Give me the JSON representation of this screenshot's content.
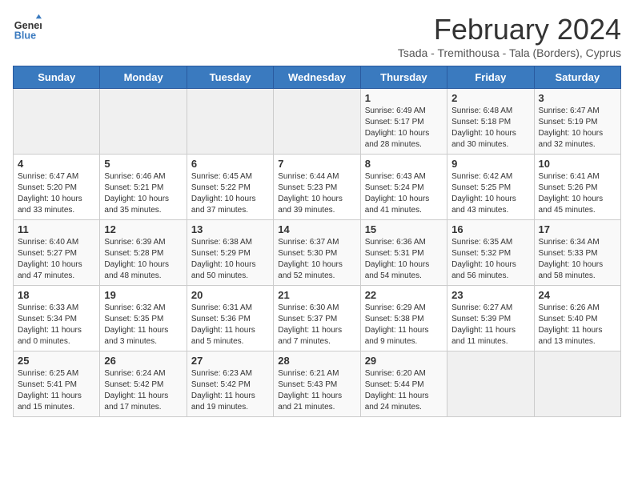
{
  "logo": {
    "general": "General",
    "blue": "Blue"
  },
  "title": "February 2024",
  "subtitle": "Tsada - Tremithousa - Tala (Borders), Cyprus",
  "days_of_week": [
    "Sunday",
    "Monday",
    "Tuesday",
    "Wednesday",
    "Thursday",
    "Friday",
    "Saturday"
  ],
  "weeks": [
    [
      {
        "day": "",
        "info": ""
      },
      {
        "day": "",
        "info": ""
      },
      {
        "day": "",
        "info": ""
      },
      {
        "day": "",
        "info": ""
      },
      {
        "day": "1",
        "info": "Sunrise: 6:49 AM\nSunset: 5:17 PM\nDaylight: 10 hours\nand 28 minutes."
      },
      {
        "day": "2",
        "info": "Sunrise: 6:48 AM\nSunset: 5:18 PM\nDaylight: 10 hours\nand 30 minutes."
      },
      {
        "day": "3",
        "info": "Sunrise: 6:47 AM\nSunset: 5:19 PM\nDaylight: 10 hours\nand 32 minutes."
      }
    ],
    [
      {
        "day": "4",
        "info": "Sunrise: 6:47 AM\nSunset: 5:20 PM\nDaylight: 10 hours\nand 33 minutes."
      },
      {
        "day": "5",
        "info": "Sunrise: 6:46 AM\nSunset: 5:21 PM\nDaylight: 10 hours\nand 35 minutes."
      },
      {
        "day": "6",
        "info": "Sunrise: 6:45 AM\nSunset: 5:22 PM\nDaylight: 10 hours\nand 37 minutes."
      },
      {
        "day": "7",
        "info": "Sunrise: 6:44 AM\nSunset: 5:23 PM\nDaylight: 10 hours\nand 39 minutes."
      },
      {
        "day": "8",
        "info": "Sunrise: 6:43 AM\nSunset: 5:24 PM\nDaylight: 10 hours\nand 41 minutes."
      },
      {
        "day": "9",
        "info": "Sunrise: 6:42 AM\nSunset: 5:25 PM\nDaylight: 10 hours\nand 43 minutes."
      },
      {
        "day": "10",
        "info": "Sunrise: 6:41 AM\nSunset: 5:26 PM\nDaylight: 10 hours\nand 45 minutes."
      }
    ],
    [
      {
        "day": "11",
        "info": "Sunrise: 6:40 AM\nSunset: 5:27 PM\nDaylight: 10 hours\nand 47 minutes."
      },
      {
        "day": "12",
        "info": "Sunrise: 6:39 AM\nSunset: 5:28 PM\nDaylight: 10 hours\nand 48 minutes."
      },
      {
        "day": "13",
        "info": "Sunrise: 6:38 AM\nSunset: 5:29 PM\nDaylight: 10 hours\nand 50 minutes."
      },
      {
        "day": "14",
        "info": "Sunrise: 6:37 AM\nSunset: 5:30 PM\nDaylight: 10 hours\nand 52 minutes."
      },
      {
        "day": "15",
        "info": "Sunrise: 6:36 AM\nSunset: 5:31 PM\nDaylight: 10 hours\nand 54 minutes."
      },
      {
        "day": "16",
        "info": "Sunrise: 6:35 AM\nSunset: 5:32 PM\nDaylight: 10 hours\nand 56 minutes."
      },
      {
        "day": "17",
        "info": "Sunrise: 6:34 AM\nSunset: 5:33 PM\nDaylight: 10 hours\nand 58 minutes."
      }
    ],
    [
      {
        "day": "18",
        "info": "Sunrise: 6:33 AM\nSunset: 5:34 PM\nDaylight: 11 hours\nand 0 minutes."
      },
      {
        "day": "19",
        "info": "Sunrise: 6:32 AM\nSunset: 5:35 PM\nDaylight: 11 hours\nand 3 minutes."
      },
      {
        "day": "20",
        "info": "Sunrise: 6:31 AM\nSunset: 5:36 PM\nDaylight: 11 hours\nand 5 minutes."
      },
      {
        "day": "21",
        "info": "Sunrise: 6:30 AM\nSunset: 5:37 PM\nDaylight: 11 hours\nand 7 minutes."
      },
      {
        "day": "22",
        "info": "Sunrise: 6:29 AM\nSunset: 5:38 PM\nDaylight: 11 hours\nand 9 minutes."
      },
      {
        "day": "23",
        "info": "Sunrise: 6:27 AM\nSunset: 5:39 PM\nDaylight: 11 hours\nand 11 minutes."
      },
      {
        "day": "24",
        "info": "Sunrise: 6:26 AM\nSunset: 5:40 PM\nDaylight: 11 hours\nand 13 minutes."
      }
    ],
    [
      {
        "day": "25",
        "info": "Sunrise: 6:25 AM\nSunset: 5:41 PM\nDaylight: 11 hours\nand 15 minutes."
      },
      {
        "day": "26",
        "info": "Sunrise: 6:24 AM\nSunset: 5:42 PM\nDaylight: 11 hours\nand 17 minutes."
      },
      {
        "day": "27",
        "info": "Sunrise: 6:23 AM\nSunset: 5:42 PM\nDaylight: 11 hours\nand 19 minutes."
      },
      {
        "day": "28",
        "info": "Sunrise: 6:21 AM\nSunset: 5:43 PM\nDaylight: 11 hours\nand 21 minutes."
      },
      {
        "day": "29",
        "info": "Sunrise: 6:20 AM\nSunset: 5:44 PM\nDaylight: 11 hours\nand 24 minutes."
      },
      {
        "day": "",
        "info": ""
      },
      {
        "day": "",
        "info": ""
      }
    ]
  ]
}
